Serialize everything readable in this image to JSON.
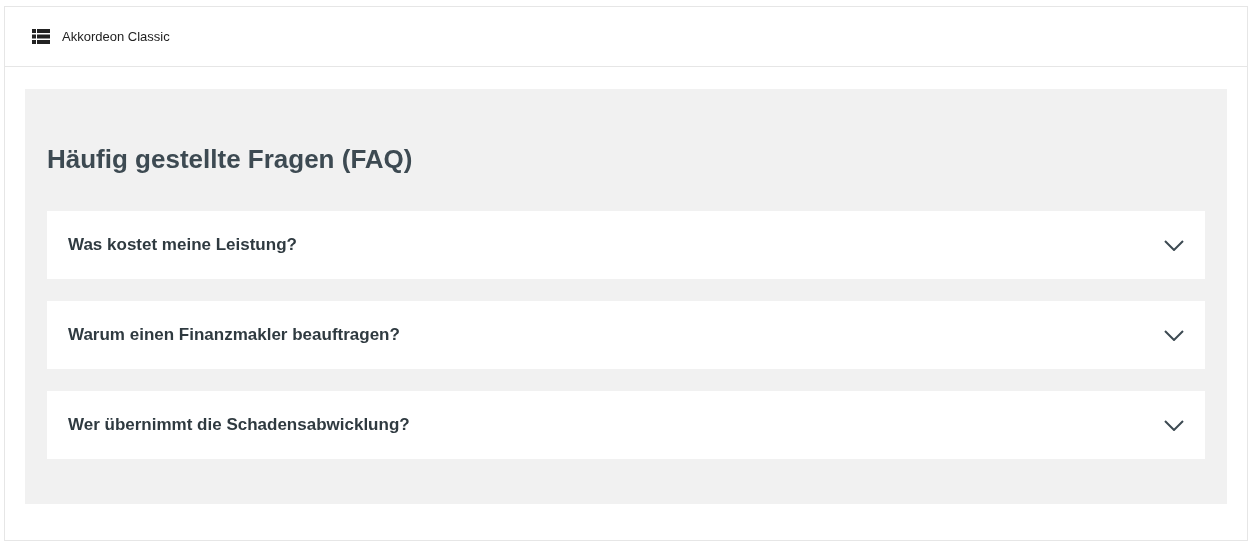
{
  "header": {
    "title": "Akkordeon Classic"
  },
  "faq": {
    "heading": "Häufig gestellte Fragen (FAQ)",
    "items": [
      {
        "question": "Was kostet meine Leistung?",
        "expanded": false
      },
      {
        "question": "Warum einen Finanzmakler beauftragen?",
        "expanded": false
      },
      {
        "question": "Wer übernimmt die Schadensabwicklung?",
        "expanded": false
      }
    ]
  }
}
